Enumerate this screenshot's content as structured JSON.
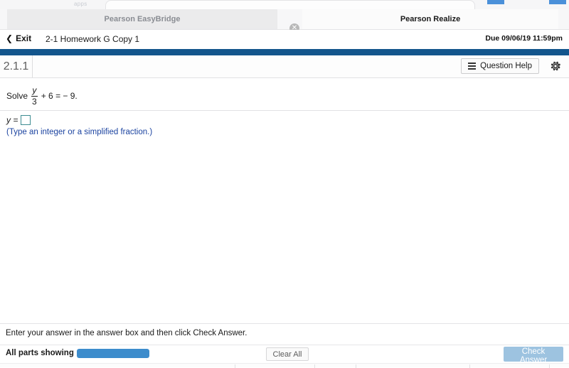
{
  "browser": {
    "faint_overflow_text": "apps",
    "close_icon": "close-circle-icon"
  },
  "tabs": [
    {
      "label": "Pearson EasyBridge",
      "active": false
    },
    {
      "label": "Pearson Realize",
      "active": true
    }
  ],
  "assignment": {
    "exit_label": "Exit",
    "back_icon": "chevron-left-icon",
    "title": "2-1 Homework G Copy 1",
    "due": "Due 09/06/19 11:59pm"
  },
  "toolbar": {
    "question_number": "2.1.1",
    "question_help_label": "Question Help",
    "help_icon": "list-icon",
    "settings_icon": "gear-icon"
  },
  "question": {
    "solve_label": "Solve",
    "fraction_numerator": "y",
    "fraction_denominator": "3",
    "expression_tail": "+ 6 = − 9.",
    "answer_label": "y =",
    "answer_value": "",
    "answer_placeholder": "",
    "hint": "(Type an integer or a simplified fraction.)"
  },
  "footer": {
    "instruction": "Enter your answer in the answer box and then click Check Answer.",
    "parts_label": "All parts showing",
    "progress_percent": 100,
    "clear_all_label": "Clear All",
    "check_answer_label": "Check Answer"
  },
  "colors": {
    "nav_blue": "#13558c",
    "progress_blue": "#3d8ccc",
    "check_answer_blue": "#9dc3e0",
    "hint_blue": "#1b43a0",
    "input_border_teal": "#3d8c91"
  }
}
